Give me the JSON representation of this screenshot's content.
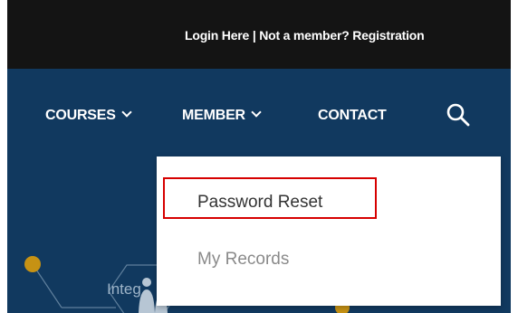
{
  "header": {
    "login_label": "Login Here",
    "separator": " | ",
    "register_label": "Not a member? Registration"
  },
  "nav": {
    "courses_label": "COURSES",
    "member_label": "MEMBER",
    "contact_label": "CONTACT"
  },
  "hero": {
    "partial_text": "Integ"
  },
  "member_menu": {
    "items": [
      {
        "label": "Password Reset"
      },
      {
        "label": "My Records"
      }
    ]
  },
  "colors": {
    "topbar": "#141414",
    "nav_background": "#11395f",
    "highlight": "#d60000",
    "accent_dot": "#c69214"
  },
  "icons": [
    "search-icon",
    "chevron-down-icon"
  ]
}
